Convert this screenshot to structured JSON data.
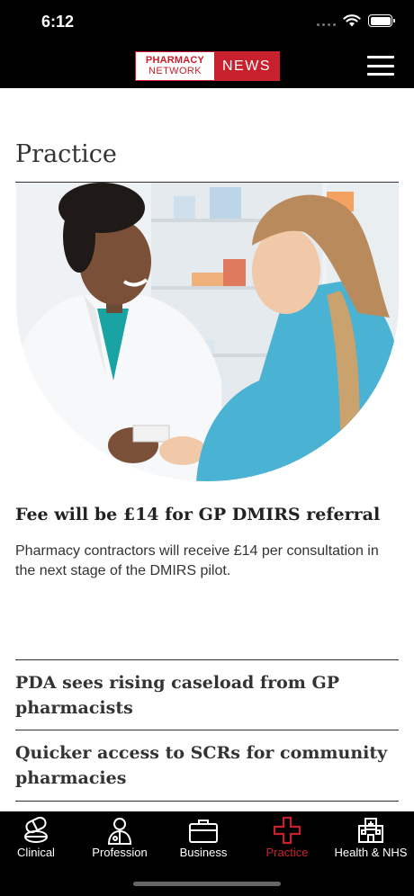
{
  "status_bar": {
    "time": "6:12"
  },
  "header": {
    "logo_line1": "PHARMACY",
    "logo_line2": "NETWORK",
    "logo_news": "NEWS"
  },
  "section": {
    "title": "Practice"
  },
  "featured": {
    "title": "Fee will be £14 for GP DMIRS referral",
    "summary": "Pharmacy contractors will receive £14 per consultation in the next stage of the DMIRS pilot."
  },
  "articles": [
    {
      "title": "PDA sees rising caseload from GP pharmacists"
    },
    {
      "title": "Quicker access to SCRs for community pharmacies"
    }
  ],
  "tabs": [
    {
      "label": "Clinical",
      "icon": "pills-icon",
      "active": false
    },
    {
      "label": "Profession",
      "icon": "pharmacist-icon",
      "active": false
    },
    {
      "label": "Business",
      "icon": "briefcase-icon",
      "active": false
    },
    {
      "label": "Practice",
      "icon": "medical-cross-icon",
      "active": true
    },
    {
      "label": "Health & NHS",
      "icon": "hospital-icon",
      "active": false
    }
  ],
  "colors": {
    "brand_red": "#c8202c",
    "bar_bg": "#000000"
  }
}
